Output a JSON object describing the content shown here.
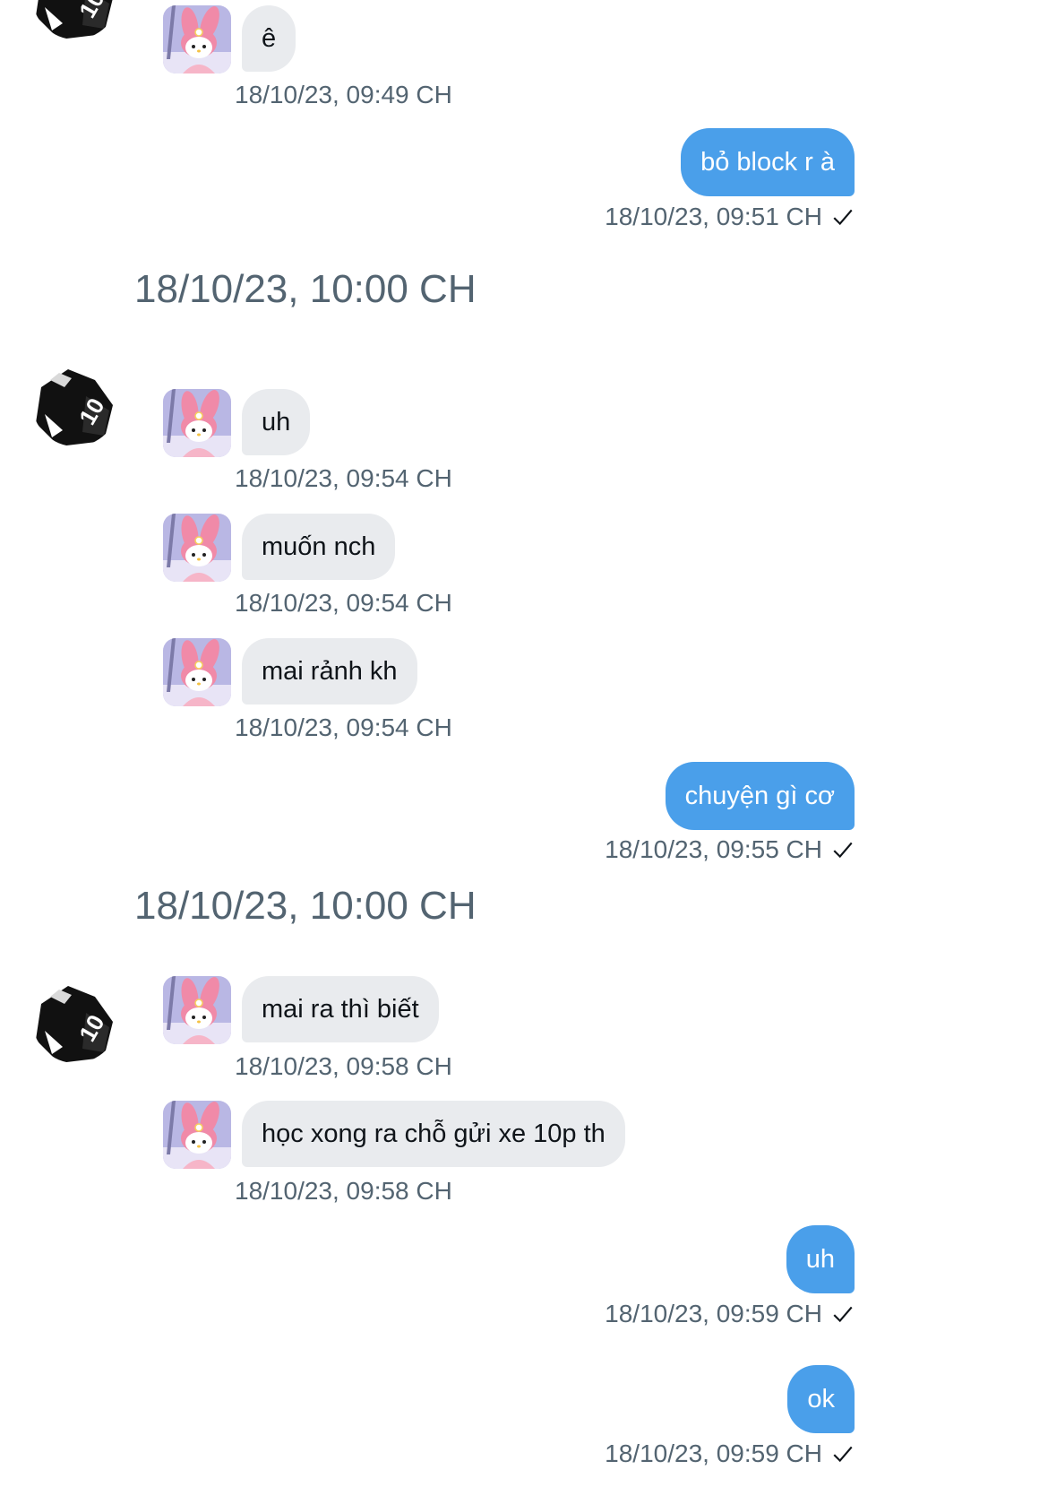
{
  "colors": {
    "sent_bubble": "#4a9fea",
    "received_bubble": "#e9ebee",
    "meta_text": "#536471"
  },
  "icons": {
    "check": "check-icon",
    "pfp_small": "melody-avatar-icon",
    "pfp_large": "kaiser-avatar-icon"
  },
  "messages": [
    {
      "text": "ê",
      "timestamp": "18/10/23, 09:49 CH"
    },
    {
      "text": "bỏ block r à",
      "timestamp": "18/10/23, 09:51 CH"
    },
    {
      "text": "uh",
      "timestamp": "18/10/23, 09:54 CH"
    },
    {
      "text": "muốn nch",
      "timestamp": "18/10/23, 09:54 CH"
    },
    {
      "text": "mai rảnh kh",
      "timestamp": "18/10/23, 09:54 CH"
    },
    {
      "text": "chuyện gì cơ",
      "timestamp": "18/10/23, 09:55 CH"
    },
    {
      "text": "mai ra thì biết",
      "timestamp": "18/10/23, 09:58 CH"
    },
    {
      "text": "học xong ra chỗ gửi xe 10p th",
      "timestamp": "18/10/23, 09:58 CH"
    },
    {
      "text": "uh",
      "timestamp": "18/10/23, 09:59 CH"
    },
    {
      "text": "ok",
      "timestamp": "18/10/23, 09:59 CH"
    }
  ],
  "dividers": [
    {
      "label": "18/10/23, 10:00 CH"
    },
    {
      "label": "18/10/23, 10:00 CH"
    }
  ]
}
